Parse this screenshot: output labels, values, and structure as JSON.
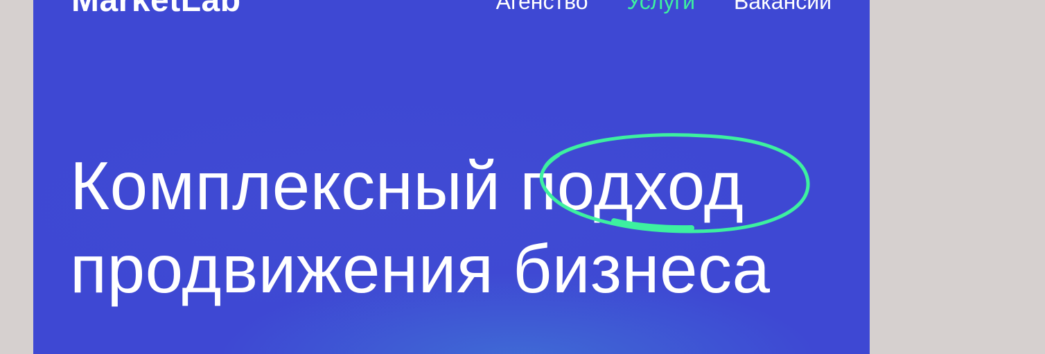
{
  "brand": {
    "logo_text": "MarketLab"
  },
  "nav": {
    "items": [
      {
        "label": "Агенство"
      },
      {
        "label": "Услуги"
      },
      {
        "label": "Вакансий"
      }
    ],
    "active_color": "#3df0a0"
  },
  "hero": {
    "line1_prefix": "Комплексный ",
    "line1_highlight": "подход",
    "line2": "продвижения бизнеса",
    "background_color": "#3e48d3",
    "highlight_stroke_color": "#3df0a0"
  }
}
